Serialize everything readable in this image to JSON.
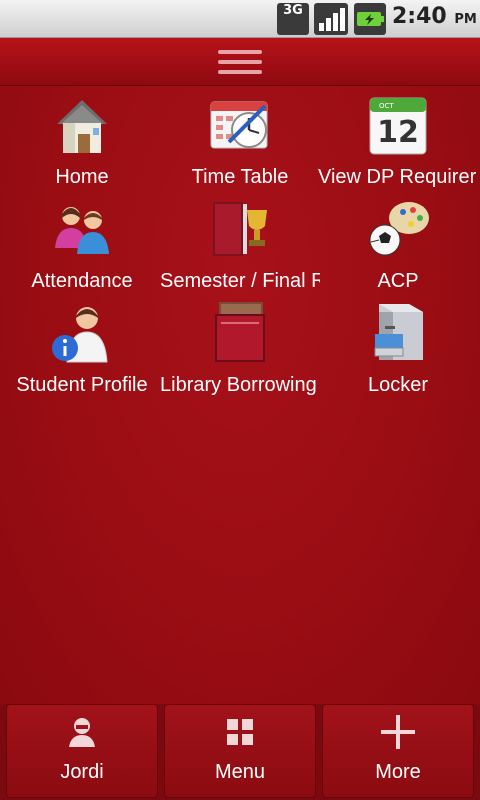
{
  "status_bar": {
    "network_label": "3G",
    "time": "2:40",
    "ampm": "PM"
  },
  "menu_button_icon": "hamburger-icon",
  "grid": [
    {
      "label": "Home",
      "icon": "house-icon"
    },
    {
      "label": "Time Table",
      "icon": "calendar-clock-icon"
    },
    {
      "label": "View DP Requirements",
      "icon": "calendar-icon"
    },
    {
      "label": "Attendance",
      "icon": "people-icon"
    },
    {
      "label": "Semester / Final Results",
      "icon": "trophy-book-icon"
    },
    {
      "label": "ACP",
      "icon": "sports-palette-icon"
    },
    {
      "label": "Student Profile",
      "icon": "student-info-icon"
    },
    {
      "label": "Library Borrowing",
      "icon": "books-icon"
    },
    {
      "label": "Locker",
      "icon": "locker-icon"
    }
  ],
  "grid_visible_labels": [
    "Home",
    "Time Table",
    "View DP Requirer",
    "Attendance",
    "Semester / Final R",
    "ACP",
    "Student Profile",
    "Library Borrowing",
    "Locker"
  ],
  "bottom_tabs": [
    {
      "label": "Jordi",
      "icon": "user-icon"
    },
    {
      "label": "Menu",
      "icon": "grid-icon"
    },
    {
      "label": "More",
      "icon": "plus-icon"
    }
  ],
  "colors": {
    "background": "#9d0e13",
    "topbar": "#b8121a",
    "text": "#ffffff"
  }
}
